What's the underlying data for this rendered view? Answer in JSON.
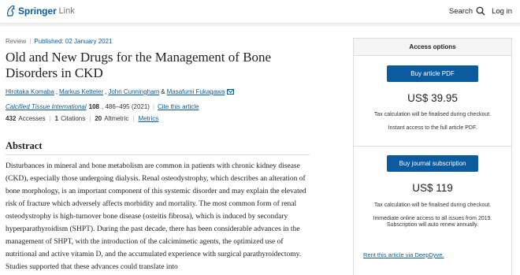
{
  "header": {
    "brand": "Springer",
    "brand_sub": "Link",
    "search_label": "Search",
    "login_label": "Log in"
  },
  "article": {
    "type": "Review",
    "published": "Published: 02 January 2021",
    "title": "Old and New Drugs for the Management of Bone Disorders in CKD",
    "authors": [
      "Hirotaka Komaba",
      "Markus Ketteler",
      "John Cunningham",
      "Masafumi Fukagawa"
    ],
    "journal": "Calcified Tissue International",
    "volume": "108",
    "pages": ", 486–495 (2021)",
    "cite_label": "Cite this article",
    "accesses_count": "432",
    "accesses_label": "Accesses",
    "citations_count": "1",
    "citations_label": "Citations",
    "altmetric_count": "20",
    "altmetric_label": "Altmetric",
    "metrics_label": "Metrics"
  },
  "abstract": {
    "heading": "Abstract",
    "text": "Disturbances in mineral and bone metabolism are common in patients with chronic kidney disease (CKD), especially those undergoing dialysis. Renal osteodystrophy, which describes an alteration of bone morphology, is an important component of this systemic disorder and may explain the elevated risk of fracture which adversely affects morbidity and mortality. The most common form of renal osteodystrophy is high-turnover bone disease (osteitis fibrosa), which is induced by secondary hyperparathyroidism (SHPT). During the past decade, there has been considerable advances in the management of SHPT, with the introduction of the calcimimetic agents, the optimized use of nutritional and active vitamin D, and the accumulated experience with surgical parathyroidectomy. Studies supported that these advances could translate into"
  },
  "access": {
    "heading": "Access options",
    "pdf_button": "Buy article PDF",
    "pdf_price": "US$ 39.95",
    "pdf_tax_note": "Tax calculation will be finalised during checkout.",
    "pdf_access_note": "Instant access to the full article PDF.",
    "sub_button": "Buy journal subscription",
    "sub_price": "US$ 119",
    "sub_tax_note": "Tax calculation will be finalised during checkout.",
    "sub_access_note_1": "Immediate online access to all issues from 2019.",
    "sub_access_note_2": "Subscription will auto renew annually.",
    "rent_link": "Rent this article via DeepDyve."
  },
  "colors": {
    "brand_blue": "#0c5b9e"
  }
}
